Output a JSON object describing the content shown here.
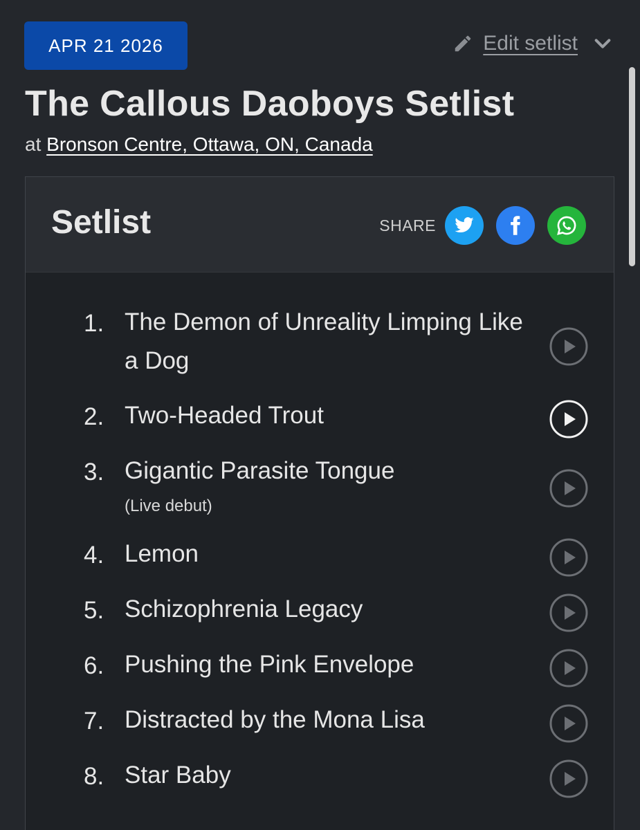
{
  "header": {
    "date": "APR 21 2026",
    "edit_label": "Edit setlist",
    "title": "The Callous Daoboys Setlist",
    "venue_prefix": "at",
    "venue": "Bronson Centre, Ottawa, ON, Canada"
  },
  "setlist": {
    "heading": "Setlist",
    "share_label": "SHARE",
    "share_icons": [
      "twitter-icon",
      "facebook-icon",
      "whatsapp-icon"
    ],
    "songs": [
      {
        "num": "1.",
        "name": "The Demon of Unreality Limping Like a Dog",
        "note": "",
        "play_active": false
      },
      {
        "num": "2.",
        "name": "Two-Headed Trout",
        "note": "",
        "play_active": true
      },
      {
        "num": "3.",
        "name": "Gigantic Parasite Tongue",
        "note": "(Live debut)",
        "play_active": false
      },
      {
        "num": "4.",
        "name": "Lemon",
        "note": "",
        "play_active": false
      },
      {
        "num": "5.",
        "name": "Schizophrenia Legacy",
        "note": "",
        "play_active": false
      },
      {
        "num": "6.",
        "name": "Pushing the Pink Envelope",
        "note": "",
        "play_active": false
      },
      {
        "num": "7.",
        "name": "Distracted by the Mona Lisa",
        "note": "",
        "play_active": false
      },
      {
        "num": "8.",
        "name": "Star Baby",
        "note": "",
        "play_active": false
      }
    ]
  },
  "colors": {
    "background": "#24272c",
    "date_badge": "#0b49a8",
    "twitter": "#1da1f2",
    "facebook": "#2d7ff0",
    "whatsapp": "#25b53c"
  }
}
